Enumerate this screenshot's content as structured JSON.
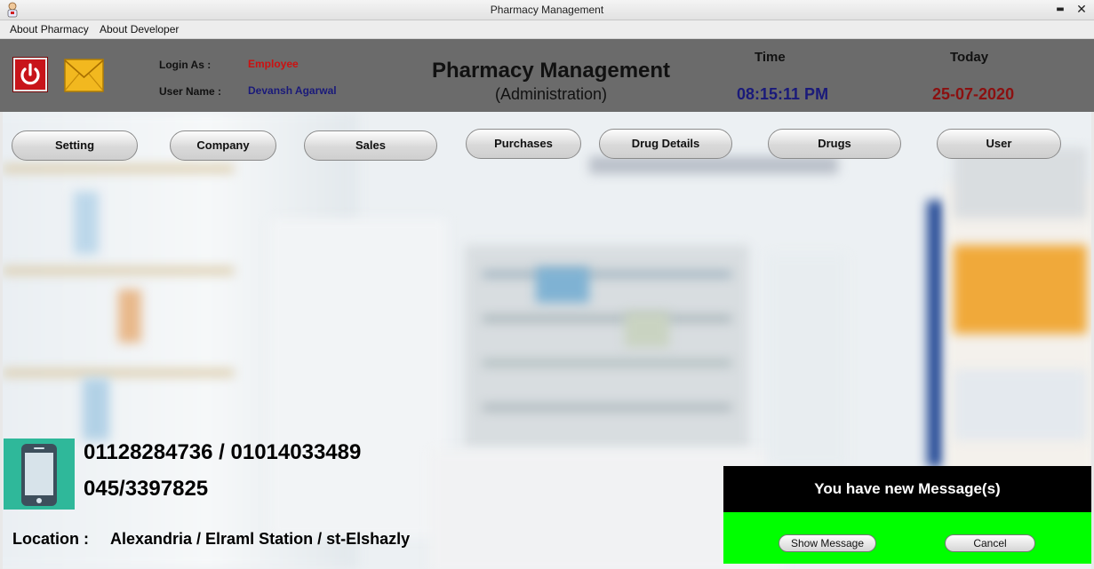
{
  "window": {
    "title": "Pharmacy Management",
    "minimize_glyph": "▬",
    "close_glyph": "✕"
  },
  "menu": {
    "items": [
      "About Pharmacy",
      "About Developer"
    ]
  },
  "header": {
    "icons": [
      "power-icon",
      "mail-icon"
    ],
    "login_label": "Login As :",
    "login_value": "Employee",
    "user_label": "User Name :",
    "user_value": "Devansh Agarwal",
    "app_title": "Pharmacy Management",
    "app_subtitle": "(Administration)",
    "time_label": "Time",
    "time_value": "08:15:11 PM",
    "date_label": "Today",
    "date_value": "25-07-2020",
    "colors": {
      "login_value": "#cc1111",
      "user_value": "#1a1a7a",
      "time_value": "#1a1a7a",
      "date_value": "#8b1010",
      "header_bg": "#6b6b6b"
    }
  },
  "nav": {
    "buttons": [
      "Setting",
      "Company",
      "Sales",
      "Purchases",
      "Drug Details",
      "Drugs",
      "User"
    ]
  },
  "contact": {
    "icon": "smartphone-icon",
    "phones": "01128284736 / 01014033489",
    "landline": "045/3397825",
    "location_label": "Location :",
    "location_value": "Alexandria / Elraml Station / st-Elshazly"
  },
  "notification": {
    "message": "You have new Message(s)",
    "show_button": "Show Message",
    "cancel_button": "Cancel",
    "colors": {
      "banner": "#000000",
      "panel": "#00ff00"
    }
  }
}
